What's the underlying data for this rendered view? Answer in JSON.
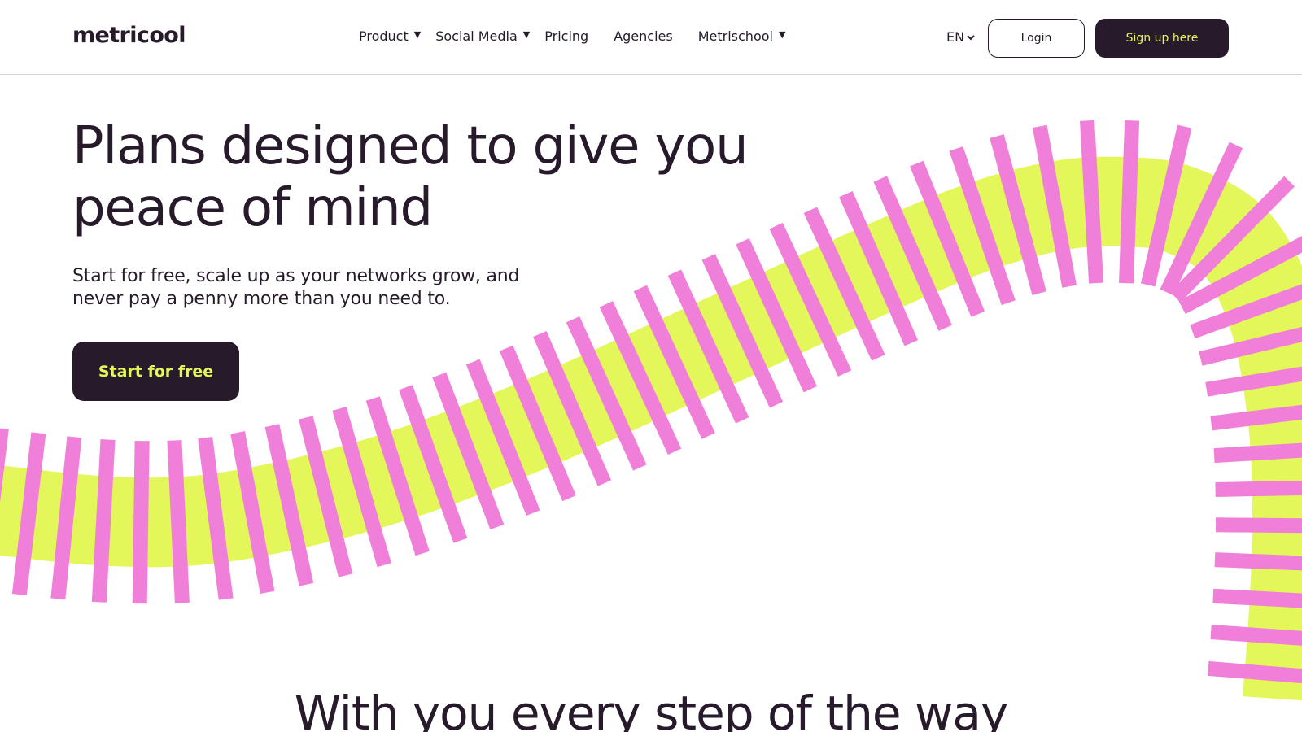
{
  "header": {
    "logo": "metricool",
    "nav": {
      "product": "Product",
      "social_media": "Social Media",
      "pricing": "Pricing",
      "agencies": "Agencies",
      "metrischool": "Metrischool"
    },
    "language": "EN",
    "login_label": "Login",
    "signup_label": "Sign up here"
  },
  "hero": {
    "title_line1": "Plans designed to give you",
    "title_line2": "peace of mind",
    "subtitle_line1": "Start for free, scale up as your networks grow, and",
    "subtitle_line2": "never pay a penny more than you need to.",
    "cta_label": "Start for free"
  },
  "section": {
    "title": "With you every step of the way"
  },
  "colors": {
    "dark": "#261a2b",
    "accent_lime": "#e3f75a",
    "accent_pink": "#f07fd9"
  },
  "icons": {
    "nav_caret": "caret-down-icon",
    "lang_chevron": "chevron-down-icon"
  }
}
